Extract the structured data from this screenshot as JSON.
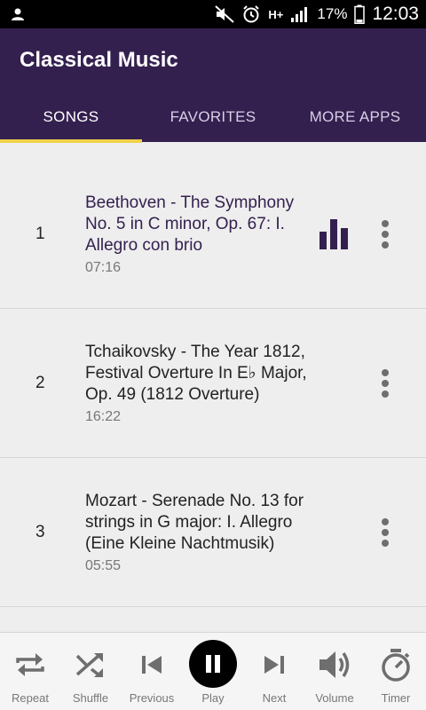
{
  "status": {
    "battery": "17%",
    "time": "12:03",
    "network": "H+"
  },
  "app": {
    "title": "Classical Music"
  },
  "tabs": [
    {
      "label": "SONGS",
      "active": true
    },
    {
      "label": "FAVORITES",
      "active": false
    },
    {
      "label": "MORE APPS",
      "active": false
    }
  ],
  "songs": [
    {
      "num": "1",
      "title": "Beethoven - The Symphony No. 5 in C minor, Op. 67: I. Allegro con brio",
      "duration": "07:16",
      "playing": true
    },
    {
      "num": "2",
      "title": "Tchaikovsky - The Year 1812, Festival Overture In E♭ Major, Op. 49 (1812 Overture)",
      "duration": "16:22",
      "playing": false
    },
    {
      "num": "3",
      "title": "Mozart - Serenade No. 13 for strings in G major: I. Allegro (Eine Kleine Nachtmusik)",
      "duration": "05:55",
      "playing": false
    }
  ],
  "player": {
    "repeat": "Repeat",
    "shuffle": "Shuffle",
    "previous": "Previous",
    "play": "Play",
    "next": "Next",
    "volume": "Volume",
    "timer": "Timer"
  },
  "colors": {
    "primary": "#34204f",
    "accent": "#f0d14a",
    "icon": "#6e6e6e"
  }
}
